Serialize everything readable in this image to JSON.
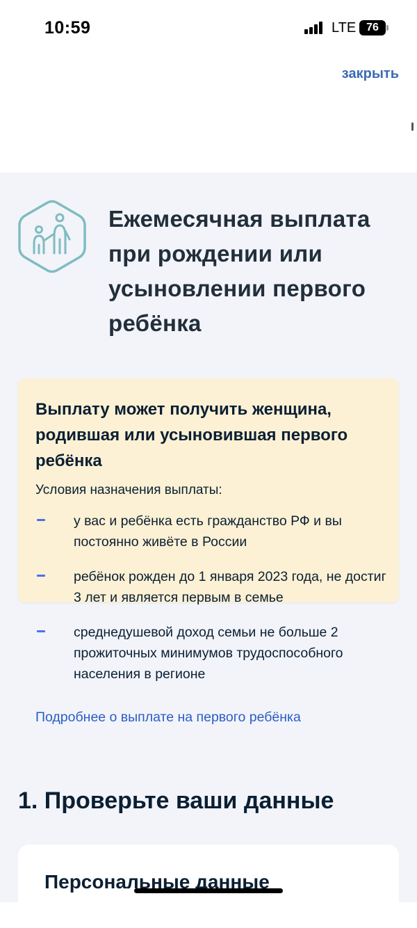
{
  "status_bar": {
    "time": "10:59",
    "network": "LTE",
    "battery": "76"
  },
  "header": {
    "close_label": "закрыть"
  },
  "service": {
    "icon": "family-icon",
    "title": "Ежемесячная выплата при рождении или усыновлении первого ребёнка"
  },
  "info_card": {
    "title": "Выплату может получить женщина, родившая или усыновившая первого ребёнка",
    "conditions_label": "Условия назначения выплаты:",
    "conditions": [
      "у вас и ребёнка есть гражданство РФ и вы постоянно живёте в России",
      "ребёнок рожден до 1 января 2023 года, не достиг 3 лет и является первым в семье",
      "среднедушевой доход семьи не больше 2 прожиточных минимумов трудоспособного населения в регионе"
    ],
    "details_link": "Подробнее о выплате на первого ребёнка"
  },
  "section": {
    "title": "1. Проверьте ваши данные"
  },
  "personal_card": {
    "title": "Персональные данные"
  },
  "colors": {
    "accent_link": "#2c5cc7",
    "info_bg": "#fcf1d4",
    "page_bg": "#f2f4f9",
    "icon_teal": "#7fbcc2",
    "dash_blue": "#4d6ff0"
  }
}
